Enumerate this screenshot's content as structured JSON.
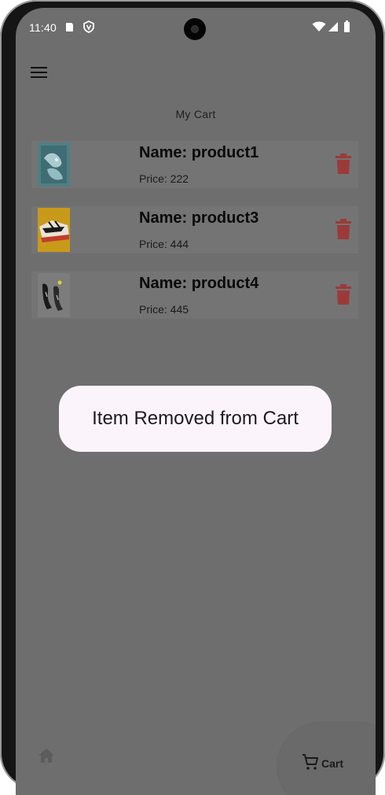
{
  "status_bar": {
    "time": "11:40"
  },
  "page": {
    "title": "My Cart"
  },
  "cart": {
    "items": [
      {
        "name": "Name: product1",
        "price": "Price: 222"
      },
      {
        "name": "Name: product3",
        "price": "Price: 444"
      },
      {
        "name": "Name: product4",
        "price": "Price: 445"
      }
    ]
  },
  "toast": {
    "message": "Item Removed from Cart"
  },
  "bottom_nav": {
    "cart_label": "Cart"
  },
  "icons": {
    "menu": "hamburger-menu-icon",
    "delete": "trash-icon",
    "home": "home-icon",
    "cart": "shopping-cart-icon"
  },
  "colors": {
    "overlay_background": "#6e6e6e",
    "delete_icon": "#9c3a3a",
    "toast_background": "#fcf4fb"
  }
}
